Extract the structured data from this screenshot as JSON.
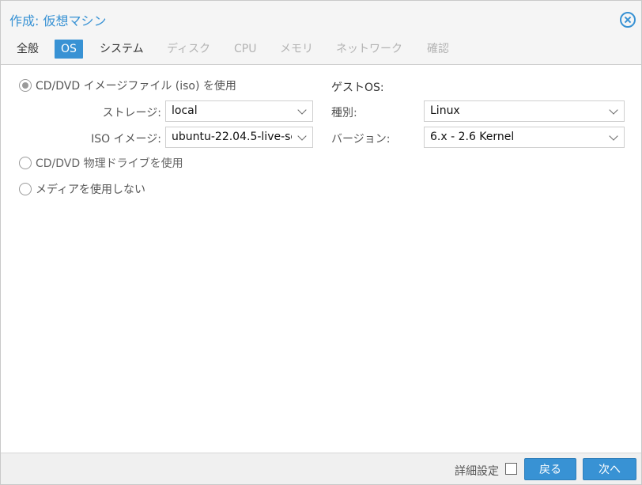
{
  "window": {
    "title": "作成: 仮想マシン"
  },
  "tabs": [
    {
      "label": "全般",
      "state": "normal"
    },
    {
      "label": "OS",
      "state": "active"
    },
    {
      "label": "システム",
      "state": "normal"
    },
    {
      "label": "ディスク",
      "state": "disabled"
    },
    {
      "label": "CPU",
      "state": "disabled"
    },
    {
      "label": "メモリ",
      "state": "disabled"
    },
    {
      "label": "ネットワーク",
      "state": "disabled"
    },
    {
      "label": "確認",
      "state": "disabled"
    }
  ],
  "media": {
    "iso_option": "CD/DVD イメージファイル (iso) を使用",
    "storage_label": "ストレージ:",
    "storage_value": "local",
    "iso_label": "ISO イメージ:",
    "iso_value": "ubuntu-22.04.5-live-se",
    "physical_option": "CD/DVD 物理ドライブを使用",
    "no_media_option": "メディアを使用しない"
  },
  "guest_os": {
    "section_label": "ゲストOS:",
    "type_label": "種別:",
    "type_value": "Linux",
    "version_label": "バージョン:",
    "version_value": "6.x - 2.6 Kernel"
  },
  "footer": {
    "advanced_label": "詳細設定",
    "back_label": "戻る",
    "next_label": "次へ"
  },
  "colors": {
    "accent": "#3892d4",
    "disabled_text": "#b3b3b3"
  }
}
